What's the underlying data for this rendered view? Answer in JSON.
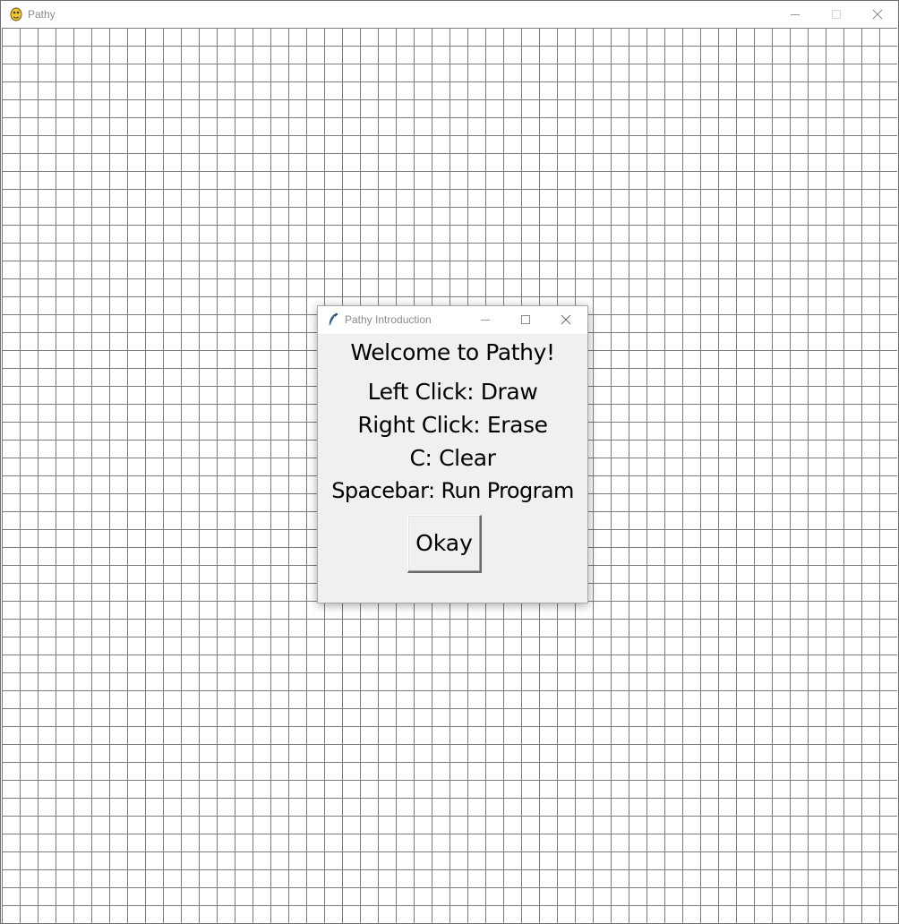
{
  "main_window": {
    "title": "Pathy",
    "app_icon": "pygame-snake-icon",
    "controls": {
      "minimize": "minimize-icon",
      "maximize": "maximize-icon",
      "close": "close-icon"
    },
    "grid": {
      "line_color": "#7a7a7a",
      "background": "#ffffff"
    }
  },
  "dialog": {
    "title": "Pathy Introduction",
    "icon": "feather-icon",
    "welcome": "Welcome to Pathy!",
    "instructions": [
      "Left Click: Draw",
      "Right Click: Erase",
      "C: Clear",
      "Spacebar: Run Program"
    ],
    "okay_label": "Okay",
    "background": "#f0f0f0"
  }
}
